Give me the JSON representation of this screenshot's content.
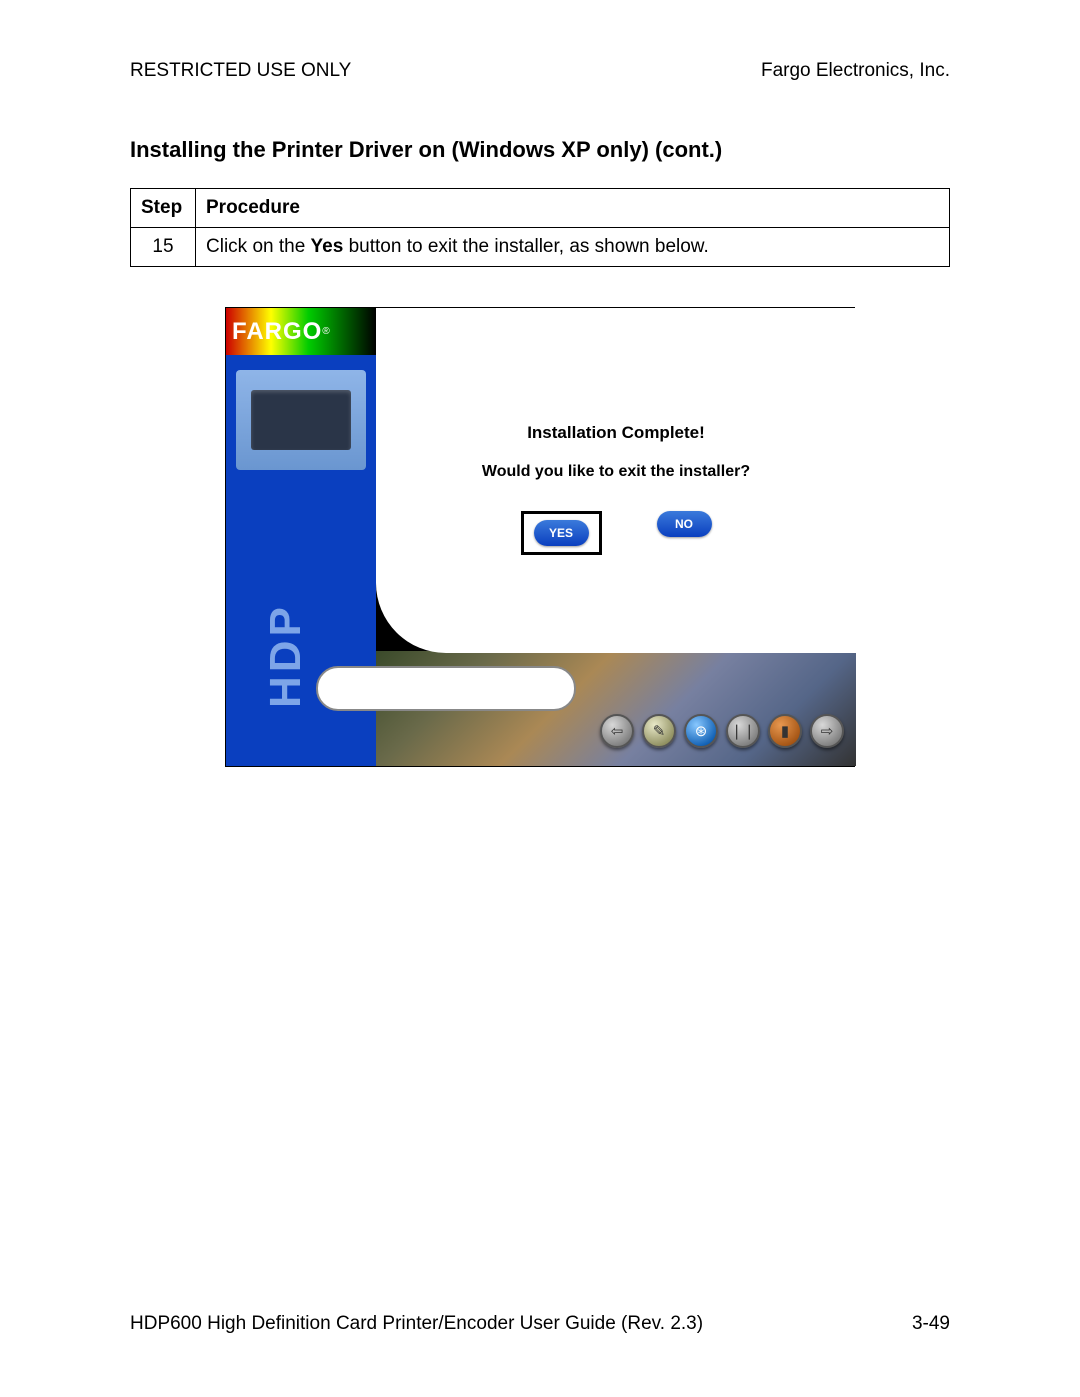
{
  "header": {
    "left": "RESTRICTED USE ONLY",
    "right": "Fargo Electronics, Inc."
  },
  "section_title": "Installing the Printer Driver on (Windows XP only) (cont.)",
  "table": {
    "headers": {
      "step": "Step",
      "procedure": "Procedure"
    },
    "row": {
      "step": "15",
      "text_pre": "Click on the ",
      "text_bold": "Yes",
      "text_post": " button to exit the installer, as shown below."
    }
  },
  "installer": {
    "logo": "FARGO",
    "logo_reg": "®",
    "side_text": "HDP",
    "message": "Installation Complete!",
    "question": "Would you like to exit the installer?",
    "yes": "YES",
    "no": "NO",
    "nav": {
      "back": "⇦",
      "pencil": "✎",
      "globe": "⊛",
      "pause": "❘❘",
      "door": "▮",
      "forward": "⇨"
    }
  },
  "footer": {
    "left": "HDP600 High Definition Card Printer/Encoder User Guide (Rev. 2.3)",
    "right": "3-49"
  }
}
